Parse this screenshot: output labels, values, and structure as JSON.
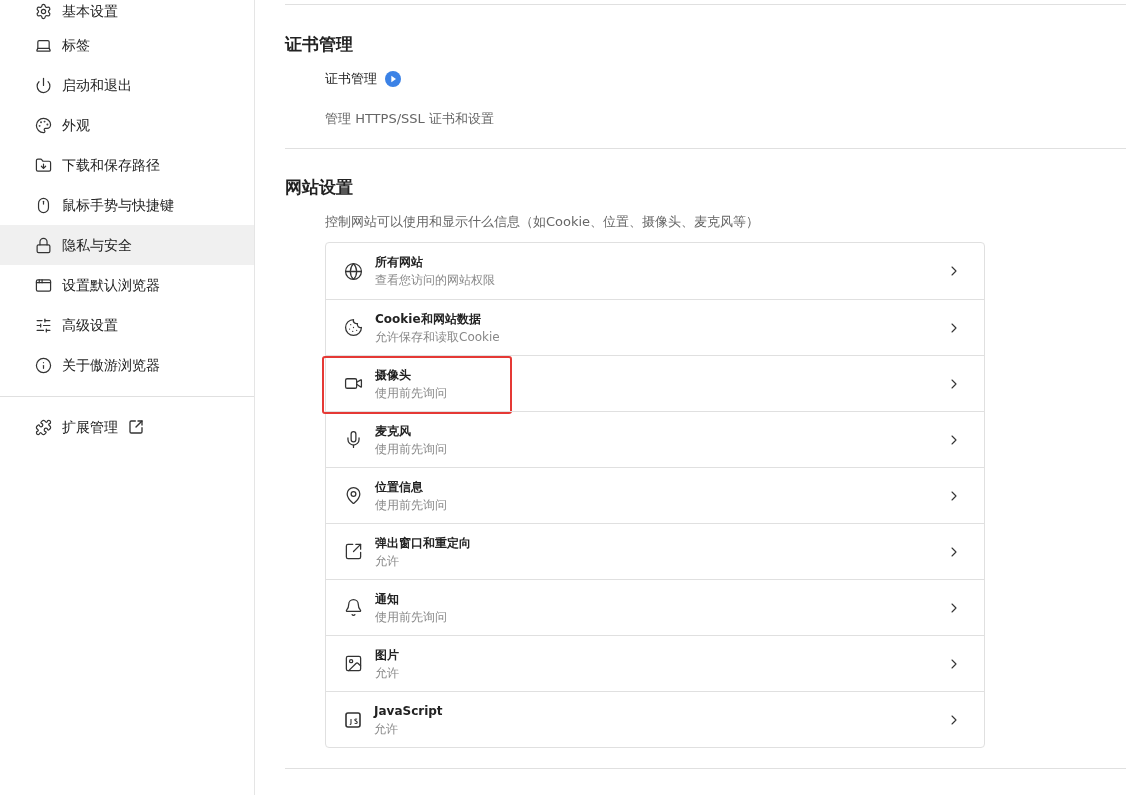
{
  "sidebar": {
    "items": [
      {
        "label": "基本设置",
        "selected": false
      },
      {
        "label": "标签",
        "selected": false
      },
      {
        "label": "启动和退出",
        "selected": false
      },
      {
        "label": "外观",
        "selected": false
      },
      {
        "label": "下载和保存路径",
        "selected": false
      },
      {
        "label": "鼠标手势与快捷键",
        "selected": false
      },
      {
        "label": "隐私与安全",
        "selected": true
      },
      {
        "label": "设置默认浏览器",
        "selected": false
      },
      {
        "label": "高级设置",
        "selected": false
      },
      {
        "label": "关于傲游浏览器",
        "selected": false
      }
    ],
    "extension_link": {
      "label": "扩展管理"
    }
  },
  "certificates": {
    "title": "证书管理",
    "link": "证书管理",
    "description": "管理 HTTPS/SSL 证书和设置"
  },
  "site_settings": {
    "title": "网站设置",
    "description": "控制网站可以使用和显示什么信息（如Cookie、位置、摄像头、麦克风等）",
    "rows": [
      {
        "title": "所有网站",
        "subtitle": "查看您访问的网站权限",
        "highlighted": false
      },
      {
        "title": "Cookie和网站数据",
        "subtitle": "允许保存和读取Cookie",
        "highlighted": false
      },
      {
        "title": "摄像头",
        "subtitle": "使用前先询问",
        "highlighted": true
      },
      {
        "title": "麦克风",
        "subtitle": "使用前先询问",
        "highlighted": false
      },
      {
        "title": "位置信息",
        "subtitle": "使用前先询问",
        "highlighted": false
      },
      {
        "title": "弹出窗口和重定向",
        "subtitle": "允许",
        "highlighted": false
      },
      {
        "title": "通知",
        "subtitle": "使用前先询问",
        "highlighted": false
      },
      {
        "title": "图片",
        "subtitle": "允许",
        "highlighted": false
      },
      {
        "title": "JavaScript",
        "subtitle": "允许",
        "highlighted": false
      }
    ]
  }
}
